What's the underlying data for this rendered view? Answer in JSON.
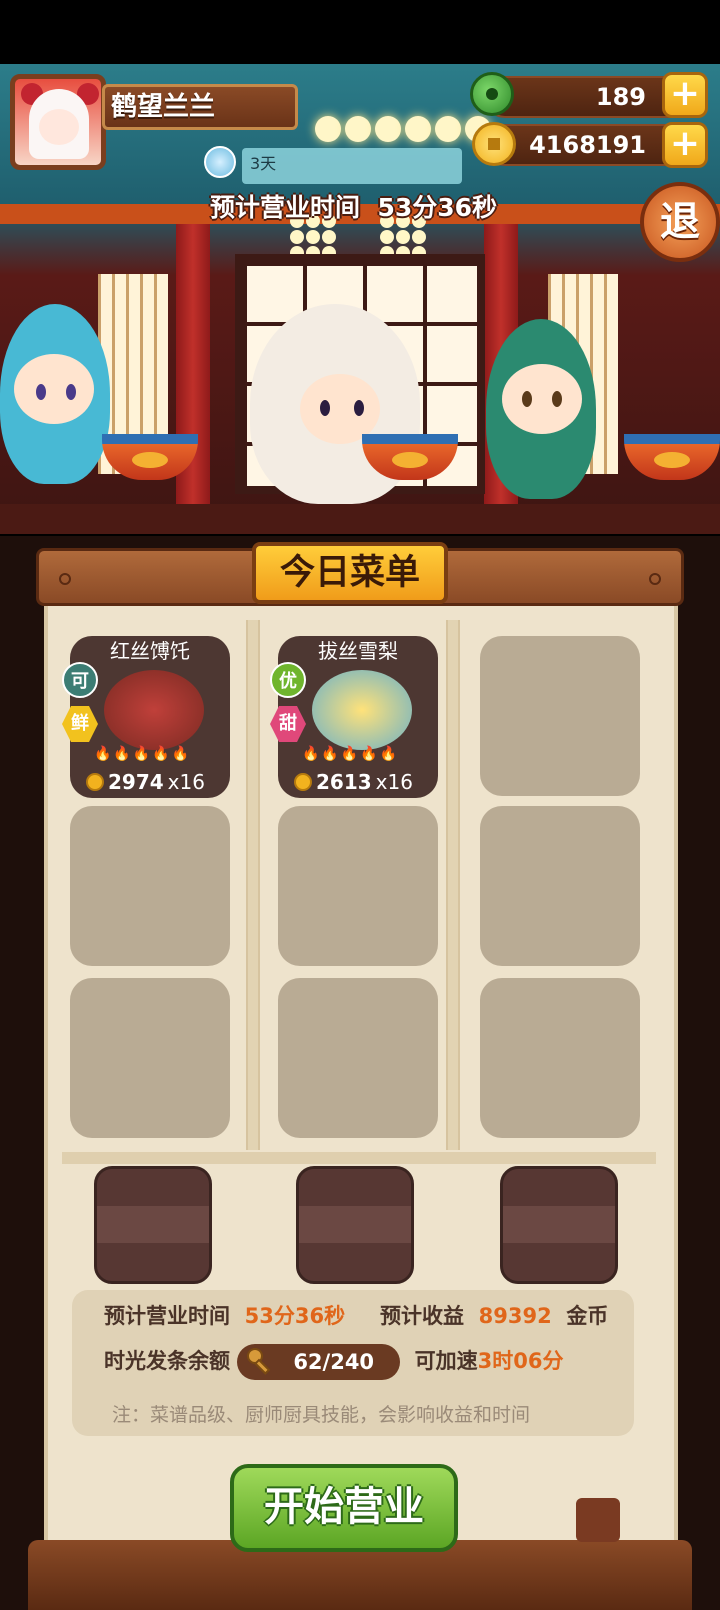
{
  "player": {
    "name": "鹤望兰兰"
  },
  "resources": {
    "jade": "189",
    "coins": "4168191",
    "plus_symbol": "+"
  },
  "status": {
    "days": "3天",
    "business_time_label": "预计营业时间",
    "business_time_value": "53分36秒"
  },
  "exit_label": "退",
  "menu": {
    "title": "今日菜单",
    "dishes": [
      {
        "name": "红丝馎饦",
        "grade_tag": "可",
        "flavor_tag": "鲜",
        "price": "2974",
        "qty": "x16",
        "grade_color": "#3c7d74",
        "flavor_color": "#f2c21e"
      },
      {
        "name": "拔丝雪梨",
        "grade_tag": "优",
        "flavor_tag": "甜",
        "price": "2613",
        "qty": "x16",
        "grade_color": "#6fb52d",
        "flavor_color": "#e0487a"
      }
    ],
    "flames": "🔥🔥🔥🔥🔥"
  },
  "info": {
    "time_label": "预计营业时间",
    "time_value": "53分36秒",
    "income_label": "预计收益",
    "income_value": "89392",
    "income_unit": "金币",
    "token_label": "时光发条余额",
    "token_value": "62/240",
    "speedup_label": "可加速",
    "speedup_value": "3时06分",
    "note": "注：菜谱品级、厨师厨具技能，会影响收益和时间"
  },
  "start_button": "开始营业",
  "colors": {
    "accent_orange": "#e0661a",
    "start_green": "#5ca624",
    "menu_gold": "#f09c1a"
  }
}
